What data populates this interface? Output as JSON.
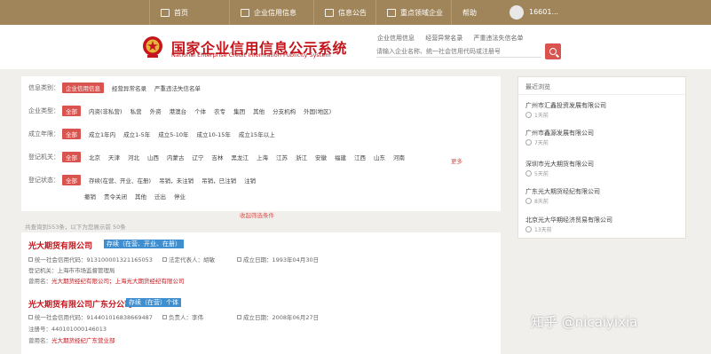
{
  "topbar": {
    "items": [
      "首页",
      "企业信用信息",
      "信息公告",
      "重点领域企业",
      "帮助"
    ],
    "username": "16601..."
  },
  "header": {
    "title": "国家企业信用信息公示系统",
    "subtitle": "National Enterprise Credit Information Publicity System",
    "search_tabs": [
      "企业信用信息",
      "经营异常名录",
      "严重违法失信名单"
    ],
    "search_placeholder": "请输入企业名称、统一社会信用代码或注册号"
  },
  "filters": [
    {
      "label": "信息类别：",
      "options": [
        "企业信用信息",
        "经营异常名录",
        "严重违法失信名单"
      ],
      "selected": 0
    },
    {
      "label": "企业类型：",
      "options": [
        "全部",
        "内资(非私营)",
        "私营",
        "外资",
        "港澳台",
        "个体",
        "农专",
        "集团",
        "其他",
        "分支机构",
        "外国(地区)"
      ],
      "selected": 0
    },
    {
      "label": "成立年限：",
      "options": [
        "全部",
        "成立1年内",
        "成立1-5年",
        "成立5-10年",
        "成立10-15年",
        "成立15年以上"
      ],
      "selected": 0
    },
    {
      "label": "登记机关：",
      "options": [
        "全部",
        "北京",
        "天津",
        "河北",
        "山西",
        "内蒙古",
        "辽宁",
        "吉林",
        "黑龙江",
        "上海",
        "江苏",
        "浙江",
        "安徽",
        "福建",
        "江西",
        "山东",
        "河南"
      ],
      "selected": 0
    },
    {
      "label": "登记状态：",
      "options": [
        "全部",
        "存续(在营、开业、在册)",
        "吊销，未注销",
        "吊销，已注销",
        "注销"
      ],
      "selected": 0
    },
    {
      "label": "",
      "options": [
        "撤销",
        "责令关闭",
        "其他",
        "迁出",
        "停业"
      ],
      "selected": -1
    }
  ],
  "more_label": "更多",
  "collapse_label": "收起筛选条件",
  "result_count": "共查询到553条，以下为您展示前 50条",
  "results": [
    {
      "name": "光大期货有限公司",
      "tag": "存续（在营、开业、在册）",
      "credit_label": "统一社会信用代码：",
      "credit_code": "913100001321165053",
      "rep_label": "法定代表人：",
      "rep": "胡敏",
      "date_label": "成立日期：",
      "date": "1993年04月30日",
      "reg_label": "登记机关：",
      "reg": "上海市市场监督管理局",
      "former_label": "曾用名：",
      "former": "光大期货经纪有限公司；上海光大期货经纪有限公司"
    },
    {
      "name": "光大期货有限公司广东分公司",
      "tag": "存续（在营）个体",
      "credit_label": "统一社会信用代码：",
      "credit_code": "914401016838669487",
      "rep_label": "负责人：",
      "rep": "李伟",
      "date_label": "成立日期：",
      "date": "2008年06月27日",
      "reg_label": "注册号：",
      "reg": "440101000146013",
      "former_label": "曾用名：",
      "former": "光大期货经纪广东营业部"
    }
  ],
  "sidebar": {
    "title": "最近浏览",
    "items": [
      {
        "name": "广州市汇鑫投资发展有限公司",
        "meta": "1天前"
      },
      {
        "name": "广州市鑫源发展有限公司",
        "meta": "7天前"
      },
      {
        "name": "深圳市光大期货有限公司",
        "meta": "5天前"
      },
      {
        "name": "广东光大期货经纪有限公司",
        "meta": "8天前"
      },
      {
        "name": "北京光大华期经济贸易有限公司",
        "meta": "13天前"
      }
    ]
  },
  "watermark": "知乎 @nicaiyixia",
  "colors": {
    "topbar": "#a0855a",
    "accent": "#d9534f",
    "brand_red": "#c4161c",
    "tag_blue": "#3e8ed0"
  }
}
